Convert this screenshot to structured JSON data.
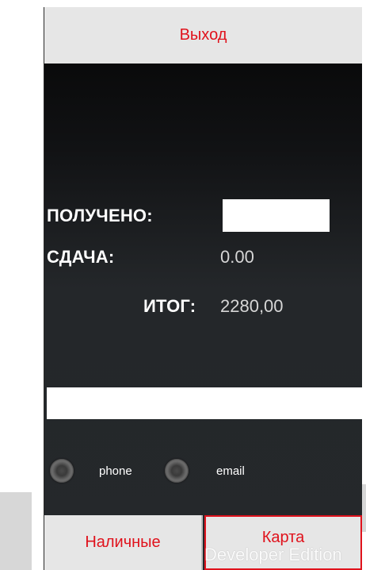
{
  "header": {
    "exit_label": "Выход"
  },
  "payment": {
    "received_label": "ПОЛУЧЕНО:",
    "received_value": "",
    "change_label": "СДАЧА:",
    "change_value": "0.00",
    "total_label": "ИТОГ:",
    "total_value": "2280,00"
  },
  "contact": {
    "value": "",
    "options": [
      {
        "label": "phone",
        "selected": false
      },
      {
        "label": "email",
        "selected": false
      }
    ]
  },
  "footer": {
    "cash_label": "Наличные",
    "card_label": "Карта"
  },
  "overlay": {
    "watermark_text": "Developer Edition"
  },
  "colors": {
    "accent_red": "#e0121c",
    "bar_gray": "#e6e6e6"
  }
}
